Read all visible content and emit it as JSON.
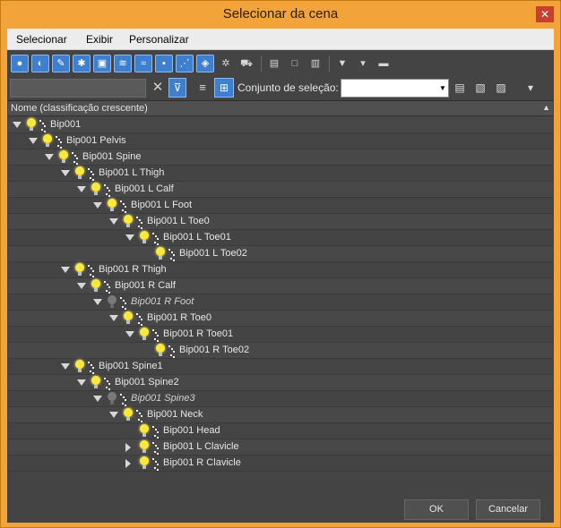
{
  "window": {
    "title": "Selecionar da cena",
    "close_glyph": "✕"
  },
  "menu": {
    "items": [
      "Selecionar",
      "Exibir",
      "Personalizar"
    ]
  },
  "toolbar1": {
    "buttons": [
      "all-objects-icon",
      "geometry-icon",
      "shapes-icon",
      "lights-icon",
      "cameras-icon",
      "helpers-icon",
      "spacewarps-icon",
      "groups-icon",
      "bones-icon",
      "xrefs-icon",
      "containers-icon",
      "frozen-icon",
      "display-children-icon",
      "display-influences-icon",
      "display-dependents-icon",
      "filter-icon",
      "filter-settings-icon",
      "options-icon"
    ]
  },
  "toolbar2": {
    "filter_value": "",
    "selection_set_label": "Conjunto de seleção:",
    "selection_set_value": ""
  },
  "tree": {
    "column_header": "Nome (classificação crescente)",
    "rows": [
      {
        "label": "Bip001",
        "depth": 0,
        "expander": "down",
        "light": true,
        "hidden": false
      },
      {
        "label": "Bip001 Pelvis",
        "depth": 1,
        "expander": "down",
        "light": true,
        "hidden": false
      },
      {
        "label": "Bip001 Spine",
        "depth": 2,
        "expander": "down",
        "light": true,
        "hidden": false
      },
      {
        "label": "Bip001 L Thigh",
        "depth": 3,
        "expander": "down",
        "light": true,
        "hidden": false
      },
      {
        "label": "Bip001 L Calf",
        "depth": 4,
        "expander": "down",
        "light": true,
        "hidden": false
      },
      {
        "label": "Bip001 L Foot",
        "depth": 5,
        "expander": "down",
        "light": true,
        "hidden": false
      },
      {
        "label": "Bip001 L Toe0",
        "depth": 6,
        "expander": "down",
        "light": true,
        "hidden": false
      },
      {
        "label": "Bip001 L Toe01",
        "depth": 7,
        "expander": "down",
        "light": true,
        "hidden": false
      },
      {
        "label": "Bip001 L Toe02",
        "depth": 8,
        "expander": "none",
        "light": true,
        "hidden": false
      },
      {
        "label": "Bip001 R Thigh",
        "depth": 3,
        "expander": "down",
        "light": true,
        "hidden": false
      },
      {
        "label": "Bip001 R Calf",
        "depth": 4,
        "expander": "down",
        "light": true,
        "hidden": false
      },
      {
        "label": "Bip001 R Foot",
        "depth": 5,
        "expander": "down",
        "light": false,
        "hidden": true
      },
      {
        "label": "Bip001 R Toe0",
        "depth": 6,
        "expander": "down",
        "light": true,
        "hidden": false
      },
      {
        "label": "Bip001 R Toe01",
        "depth": 7,
        "expander": "down",
        "light": true,
        "hidden": false
      },
      {
        "label": "Bip001 R Toe02",
        "depth": 8,
        "expander": "none",
        "light": true,
        "hidden": false
      },
      {
        "label": "Bip001 Spine1",
        "depth": 3,
        "expander": "down",
        "light": true,
        "hidden": false
      },
      {
        "label": "Bip001 Spine2",
        "depth": 4,
        "expander": "down",
        "light": true,
        "hidden": false
      },
      {
        "label": "Bip001 Spine3",
        "depth": 5,
        "expander": "down",
        "light": false,
        "hidden": true
      },
      {
        "label": "Bip001 Neck",
        "depth": 6,
        "expander": "down",
        "light": true,
        "hidden": false
      },
      {
        "label": "Bip001 Head",
        "depth": 7,
        "expander": "none",
        "light": true,
        "hidden": false
      },
      {
        "label": "Bip001 L Clavicle",
        "depth": 7,
        "expander": "right",
        "light": true,
        "hidden": false
      },
      {
        "label": "Bip001 R Clavicle",
        "depth": 7,
        "expander": "right",
        "light": true,
        "hidden": false
      }
    ]
  },
  "footer": {
    "ok_label": "OK",
    "cancel_label": "Cancelar"
  },
  "colors": {
    "accent": "#3f7fd0",
    "titlebar": "#f2a33a",
    "panel": "#444444",
    "bulb_on": "#ffe83a"
  }
}
